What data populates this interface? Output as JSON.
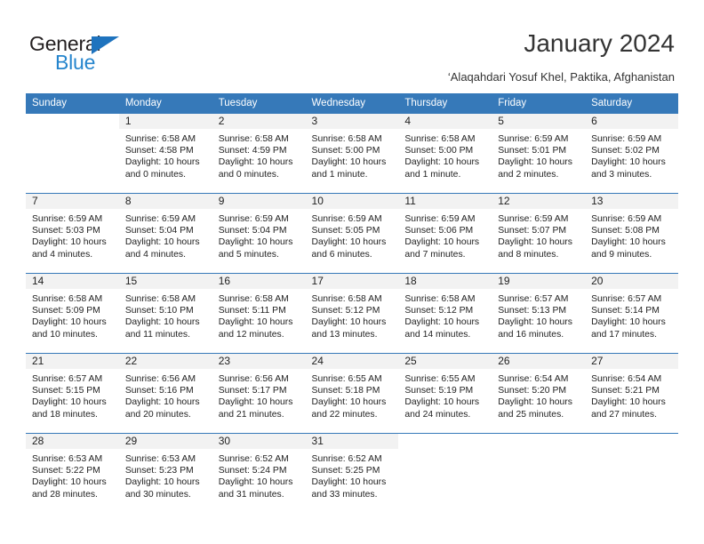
{
  "brand": {
    "name_top": "General",
    "name_bottom": "Blue",
    "accent_color": "#2585cd",
    "triangle_color": "#1e73be"
  },
  "header": {
    "title": "January 2024",
    "subtitle": "‘Alaqahdari Yosuf Khel, Paktika, Afghanistan"
  },
  "calendar": {
    "header_bg": "#3679b9",
    "daynum_bg": "#f2f2f2",
    "weekday_headers": [
      "Sunday",
      "Monday",
      "Tuesday",
      "Wednesday",
      "Thursday",
      "Friday",
      "Saturday"
    ],
    "weeks": [
      [
        {
          "day": "",
          "sunrise": "",
          "sunset": "",
          "daylight_line1": "",
          "daylight_line2": ""
        },
        {
          "day": "1",
          "sunrise": "Sunrise: 6:58 AM",
          "sunset": "Sunset: 4:58 PM",
          "daylight_line1": "Daylight: 10 hours",
          "daylight_line2": "and 0 minutes."
        },
        {
          "day": "2",
          "sunrise": "Sunrise: 6:58 AM",
          "sunset": "Sunset: 4:59 PM",
          "daylight_line1": "Daylight: 10 hours",
          "daylight_line2": "and 0 minutes."
        },
        {
          "day": "3",
          "sunrise": "Sunrise: 6:58 AM",
          "sunset": "Sunset: 5:00 PM",
          "daylight_line1": "Daylight: 10 hours",
          "daylight_line2": "and 1 minute."
        },
        {
          "day": "4",
          "sunrise": "Sunrise: 6:58 AM",
          "sunset": "Sunset: 5:00 PM",
          "daylight_line1": "Daylight: 10 hours",
          "daylight_line2": "and 1 minute."
        },
        {
          "day": "5",
          "sunrise": "Sunrise: 6:59 AM",
          "sunset": "Sunset: 5:01 PM",
          "daylight_line1": "Daylight: 10 hours",
          "daylight_line2": "and 2 minutes."
        },
        {
          "day": "6",
          "sunrise": "Sunrise: 6:59 AM",
          "sunset": "Sunset: 5:02 PM",
          "daylight_line1": "Daylight: 10 hours",
          "daylight_line2": "and 3 minutes."
        }
      ],
      [
        {
          "day": "7",
          "sunrise": "Sunrise: 6:59 AM",
          "sunset": "Sunset: 5:03 PM",
          "daylight_line1": "Daylight: 10 hours",
          "daylight_line2": "and 4 minutes."
        },
        {
          "day": "8",
          "sunrise": "Sunrise: 6:59 AM",
          "sunset": "Sunset: 5:04 PM",
          "daylight_line1": "Daylight: 10 hours",
          "daylight_line2": "and 4 minutes."
        },
        {
          "day": "9",
          "sunrise": "Sunrise: 6:59 AM",
          "sunset": "Sunset: 5:04 PM",
          "daylight_line1": "Daylight: 10 hours",
          "daylight_line2": "and 5 minutes."
        },
        {
          "day": "10",
          "sunrise": "Sunrise: 6:59 AM",
          "sunset": "Sunset: 5:05 PM",
          "daylight_line1": "Daylight: 10 hours",
          "daylight_line2": "and 6 minutes."
        },
        {
          "day": "11",
          "sunrise": "Sunrise: 6:59 AM",
          "sunset": "Sunset: 5:06 PM",
          "daylight_line1": "Daylight: 10 hours",
          "daylight_line2": "and 7 minutes."
        },
        {
          "day": "12",
          "sunrise": "Sunrise: 6:59 AM",
          "sunset": "Sunset: 5:07 PM",
          "daylight_line1": "Daylight: 10 hours",
          "daylight_line2": "and 8 minutes."
        },
        {
          "day": "13",
          "sunrise": "Sunrise: 6:59 AM",
          "sunset": "Sunset: 5:08 PM",
          "daylight_line1": "Daylight: 10 hours",
          "daylight_line2": "and 9 minutes."
        }
      ],
      [
        {
          "day": "14",
          "sunrise": "Sunrise: 6:58 AM",
          "sunset": "Sunset: 5:09 PM",
          "daylight_line1": "Daylight: 10 hours",
          "daylight_line2": "and 10 minutes."
        },
        {
          "day": "15",
          "sunrise": "Sunrise: 6:58 AM",
          "sunset": "Sunset: 5:10 PM",
          "daylight_line1": "Daylight: 10 hours",
          "daylight_line2": "and 11 minutes."
        },
        {
          "day": "16",
          "sunrise": "Sunrise: 6:58 AM",
          "sunset": "Sunset: 5:11 PM",
          "daylight_line1": "Daylight: 10 hours",
          "daylight_line2": "and 12 minutes."
        },
        {
          "day": "17",
          "sunrise": "Sunrise: 6:58 AM",
          "sunset": "Sunset: 5:12 PM",
          "daylight_line1": "Daylight: 10 hours",
          "daylight_line2": "and 13 minutes."
        },
        {
          "day": "18",
          "sunrise": "Sunrise: 6:58 AM",
          "sunset": "Sunset: 5:12 PM",
          "daylight_line1": "Daylight: 10 hours",
          "daylight_line2": "and 14 minutes."
        },
        {
          "day": "19",
          "sunrise": "Sunrise: 6:57 AM",
          "sunset": "Sunset: 5:13 PM",
          "daylight_line1": "Daylight: 10 hours",
          "daylight_line2": "and 16 minutes."
        },
        {
          "day": "20",
          "sunrise": "Sunrise: 6:57 AM",
          "sunset": "Sunset: 5:14 PM",
          "daylight_line1": "Daylight: 10 hours",
          "daylight_line2": "and 17 minutes."
        }
      ],
      [
        {
          "day": "21",
          "sunrise": "Sunrise: 6:57 AM",
          "sunset": "Sunset: 5:15 PM",
          "daylight_line1": "Daylight: 10 hours",
          "daylight_line2": "and 18 minutes."
        },
        {
          "day": "22",
          "sunrise": "Sunrise: 6:56 AM",
          "sunset": "Sunset: 5:16 PM",
          "daylight_line1": "Daylight: 10 hours",
          "daylight_line2": "and 20 minutes."
        },
        {
          "day": "23",
          "sunrise": "Sunrise: 6:56 AM",
          "sunset": "Sunset: 5:17 PM",
          "daylight_line1": "Daylight: 10 hours",
          "daylight_line2": "and 21 minutes."
        },
        {
          "day": "24",
          "sunrise": "Sunrise: 6:55 AM",
          "sunset": "Sunset: 5:18 PM",
          "daylight_line1": "Daylight: 10 hours",
          "daylight_line2": "and 22 minutes."
        },
        {
          "day": "25",
          "sunrise": "Sunrise: 6:55 AM",
          "sunset": "Sunset: 5:19 PM",
          "daylight_line1": "Daylight: 10 hours",
          "daylight_line2": "and 24 minutes."
        },
        {
          "day": "26",
          "sunrise": "Sunrise: 6:54 AM",
          "sunset": "Sunset: 5:20 PM",
          "daylight_line1": "Daylight: 10 hours",
          "daylight_line2": "and 25 minutes."
        },
        {
          "day": "27",
          "sunrise": "Sunrise: 6:54 AM",
          "sunset": "Sunset: 5:21 PM",
          "daylight_line1": "Daylight: 10 hours",
          "daylight_line2": "and 27 minutes."
        }
      ],
      [
        {
          "day": "28",
          "sunrise": "Sunrise: 6:53 AM",
          "sunset": "Sunset: 5:22 PM",
          "daylight_line1": "Daylight: 10 hours",
          "daylight_line2": "and 28 minutes."
        },
        {
          "day": "29",
          "sunrise": "Sunrise: 6:53 AM",
          "sunset": "Sunset: 5:23 PM",
          "daylight_line1": "Daylight: 10 hours",
          "daylight_line2": "and 30 minutes."
        },
        {
          "day": "30",
          "sunrise": "Sunrise: 6:52 AM",
          "sunset": "Sunset: 5:24 PM",
          "daylight_line1": "Daylight: 10 hours",
          "daylight_line2": "and 31 minutes."
        },
        {
          "day": "31",
          "sunrise": "Sunrise: 6:52 AM",
          "sunset": "Sunset: 5:25 PM",
          "daylight_line1": "Daylight: 10 hours",
          "daylight_line2": "and 33 minutes."
        },
        {
          "day": "",
          "sunrise": "",
          "sunset": "",
          "daylight_line1": "",
          "daylight_line2": ""
        },
        {
          "day": "",
          "sunrise": "",
          "sunset": "",
          "daylight_line1": "",
          "daylight_line2": ""
        },
        {
          "day": "",
          "sunrise": "",
          "sunset": "",
          "daylight_line1": "",
          "daylight_line2": ""
        }
      ]
    ]
  }
}
